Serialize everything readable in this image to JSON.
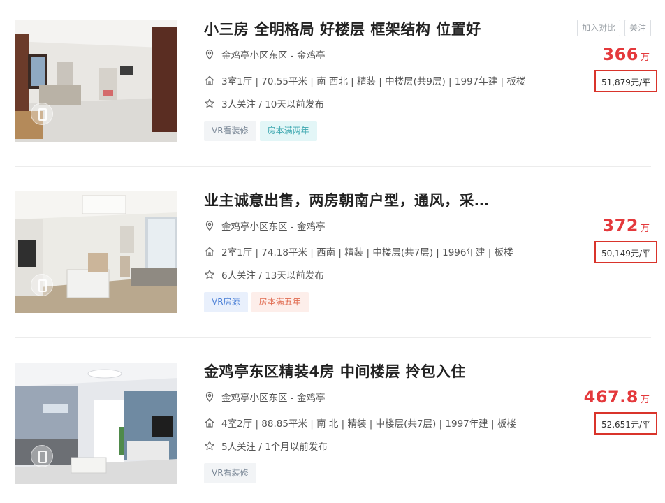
{
  "actions": {
    "compare_label": "加入对比",
    "follow_label": "关注"
  },
  "listings": [
    {
      "title": "小三房 全明格局 好楼层 框架结构 位置好",
      "location": "金鸡亭小区东区 - 金鸡亭",
      "info": "3室1厅 | 70.55平米 | 南 西北 | 精装 | 中楼层(共9层) | 1997年建 | 板楼",
      "follow": "3人关注 / 10天以前发布",
      "tags": [
        "VR看装修",
        "房本满两年"
      ],
      "price": "366",
      "price_unit": "万",
      "unit_price": "51,879元/平"
    },
    {
      "title": "业主诚意出售，两房朝南户型，通风，采…",
      "location": "金鸡亭小区东区 - 金鸡亭",
      "info": "2室1厅 | 74.18平米 | 西南 | 精装 | 中楼层(共7层) | 1996年建 | 板楼",
      "follow": "6人关注 / 13天以前发布",
      "tags": [
        "VR房源",
        "房本满五年"
      ],
      "price": "372",
      "price_unit": "万",
      "unit_price": "50,149元/平"
    },
    {
      "title": "金鸡亭东区精装4房 中间楼层 拎包入住",
      "location": "金鸡亭小区东区 - 金鸡亭",
      "info": "4室2厅 | 88.85平米 | 南 北 | 精装 | 中楼层(共7层) | 1997年建 | 板楼",
      "follow": "5人关注 / 1个月以前发布",
      "tags": [
        "VR看装修"
      ],
      "price": "467.8",
      "price_unit": "万",
      "unit_price": "52,651元/平"
    }
  ],
  "icons": {
    "location": "location-pin-icon",
    "house": "house-icon",
    "follow": "star-icon",
    "vr": "vr-badge-icon"
  },
  "colors": {
    "price": "#e4393c",
    "highlight_box": "#d9342b",
    "tag_teal": "#3ea8b0",
    "tag_blue": "#4a7fd6",
    "tag_red": "#e06b50",
    "tag_gray": "#7a8796"
  }
}
